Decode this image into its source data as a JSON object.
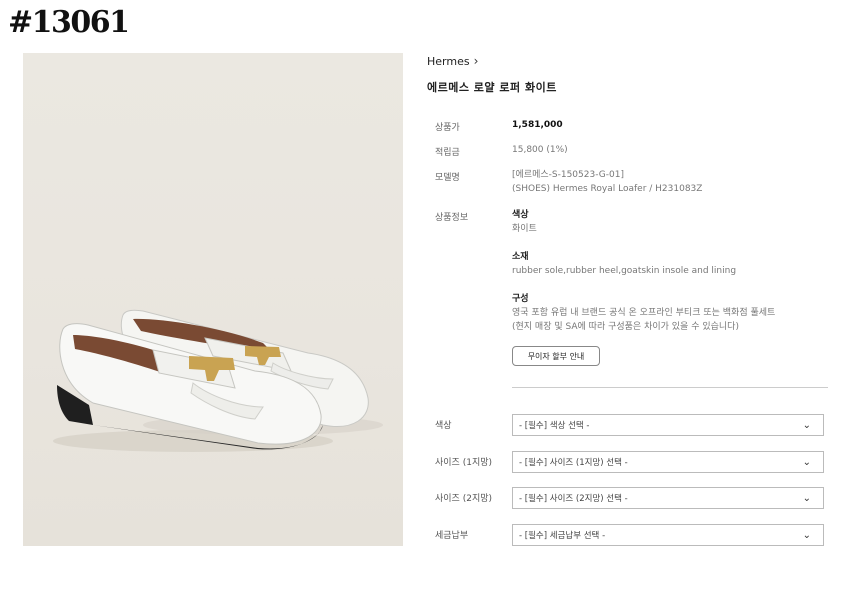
{
  "code": "#13061",
  "breadcrumb": {
    "brand": "Hermes",
    "chevron": "›"
  },
  "product": {
    "name": "에르메스 로얄 로퍼 화이트",
    "image_alt": "white loafer pair"
  },
  "details": {
    "price_label": "상품가",
    "price": "1,581,000",
    "points_label": "적립금",
    "points": "15,800 (1%)",
    "model_label": "모델명",
    "model_line1": "[에르메스-S-150523-G-01]",
    "model_line2": "(SHOES) Hermes Royal Loafer / H231083Z",
    "info_label": "상품정보",
    "color_title": "색상",
    "color_value": "화이트",
    "material_title": "소재",
    "material_value": "rubber sole,rubber heel,goatskin insole and lining",
    "composition_title": "구성",
    "composition_line1": "영국 포함 유럽 내 브랜드 공식 온 오프라인 부티크 또는 백화점 풀세트",
    "composition_line2": "(현지 매장 및 SA에 따라 구성품은 차이가 있을 수 있습니다)",
    "guide_button": "무이자 할부 안내"
  },
  "options": [
    {
      "label": "색상",
      "placeholder": "- [필수] 색상 선택 -"
    },
    {
      "label": "사이즈 (1지망)",
      "placeholder": "- [필수] 사이즈 (1지망) 선택 -"
    },
    {
      "label": "사이즈 (2지망)",
      "placeholder": "- [필수] 사이즈 (2지망) 선택 -"
    },
    {
      "label": "세금납부",
      "placeholder": "- [필수] 세금납부 선택 -"
    }
  ],
  "colors": {
    "image_bg": "#ebe8e1",
    "shoe_white": "#f7f7f5",
    "sole": "#1f1f1f",
    "lining": "#7a4a33",
    "hardware_gold": "#c9a352"
  },
  "icons": {
    "select_arrow": "chevron-down-icon"
  }
}
